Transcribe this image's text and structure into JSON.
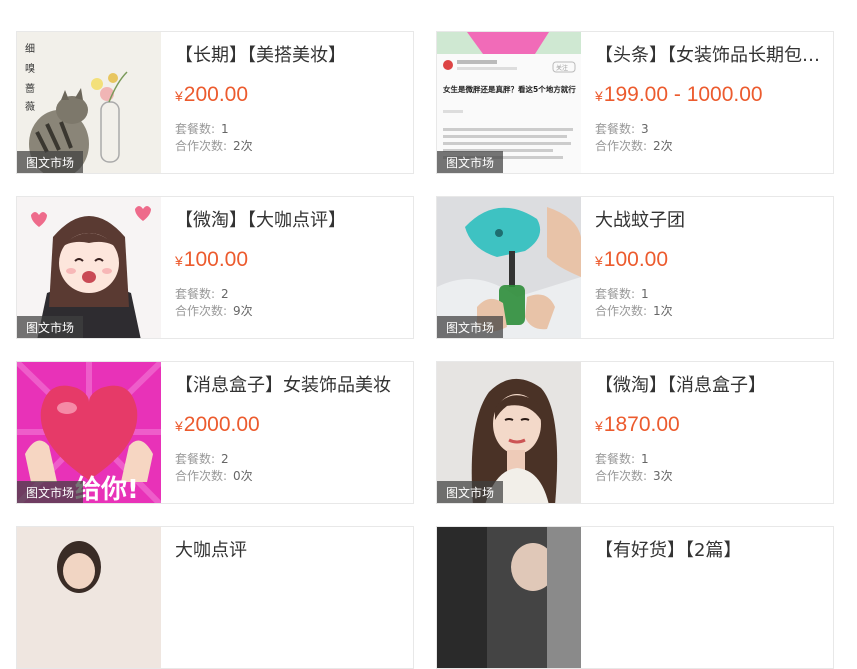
{
  "tag_label": "图文市场",
  "labels": {
    "packages": "套餐数:",
    "cooperations": "合作次数:"
  },
  "cards": [
    {
      "title": "【长期】【美搭美妆】",
      "currency": "¥",
      "price": "200.00",
      "packages": "1",
      "cooperations": "2次",
      "thumb": "cat-illustration"
    },
    {
      "title": "【头条】【女装饰品长期包年】",
      "currency": "¥",
      "price": "199.00 - 1000.00",
      "packages": "3",
      "cooperations": "2次",
      "thumb": "article-screenshot",
      "thumb_text": {
        "headline": "女生是微胖还是真胖？看这5个地方就行",
        "follow": "关注"
      }
    },
    {
      "title": "【微淘】【大咖点评】",
      "currency": "¥",
      "price": "100.00",
      "packages": "2",
      "cooperations": "9次",
      "thumb": "anime-girl"
    },
    {
      "title": "大战蚊子团",
      "currency": "¥",
      "price": "100.00",
      "packages": "1",
      "cooperations": "1次",
      "thumb": "mosquito-repellent"
    },
    {
      "title": "【消息盒子】女装饰品美妆",
      "currency": "¥",
      "price": "2000.00",
      "packages": "2",
      "cooperations": "0次",
      "thumb": "heart-sticker",
      "thumb_text": {
        "overlay": "给你!"
      }
    },
    {
      "title": "【微淘】【消息盒子】",
      "currency": "¥",
      "price": "1870.00",
      "packages": "1",
      "cooperations": "3次",
      "thumb": "woman-portrait"
    },
    {
      "title": "大咖点评",
      "thumb": "girl-photo"
    },
    {
      "title": "【有好货】【2篇】",
      "thumb": "car-photo"
    }
  ],
  "colors": {
    "price": "#ec5b2e",
    "title": "#333333",
    "label": "#999999",
    "tag_bg": "#404040"
  }
}
